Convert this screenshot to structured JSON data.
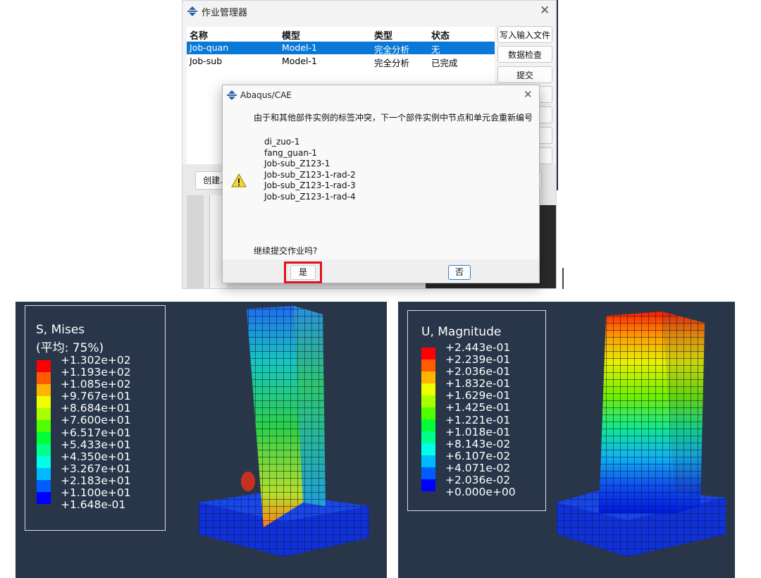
{
  "job_manager": {
    "title": "作业管理器",
    "columns": [
      "名称",
      "模型",
      "类型",
      "状态"
    ],
    "rows": [
      {
        "name": "Job-quan",
        "model": "Model-1",
        "type": "完全分析",
        "status": "无",
        "selected": true
      },
      {
        "name": "Job-sub",
        "model": "Model-1",
        "type": "完全分析",
        "status": "已完成",
        "selected": false
      }
    ],
    "buttons": {
      "write_input": "写入输入文件",
      "data_check": "数据检查",
      "submit": "提交",
      "create": "创建."
    }
  },
  "dialog": {
    "title": "Abaqus/CAE",
    "message": "由于和其他部件实例的标签冲突，下一个部件实例中节点和单元会重新编号",
    "instances": [
      "di_zuo-1",
      "fang_guan-1",
      "Job-sub_Z123-1",
      "Job-sub_Z123-1-rad-2",
      "Job-sub_Z123-1-rad-3",
      "Job-sub_Z123-1-rad-4"
    ],
    "question": "继续提交作业吗?",
    "yes_label": "是",
    "no_label": "否",
    "warning_icon": "warning-triangle-icon"
  },
  "stress_plot": {
    "title": "S, Mises",
    "subtitle": "(平均: 75%)",
    "values": [
      "+1.302e+02",
      "+1.193e+02",
      "+1.085e+02",
      "+9.767e+01",
      "+8.684e+01",
      "+7.600e+01",
      "+6.517e+01",
      "+5.433e+01",
      "+4.350e+01",
      "+3.267e+01",
      "+2.183e+01",
      "+1.100e+01",
      "+1.648e-01"
    ]
  },
  "displacement_plot": {
    "title": "U, Magnitude",
    "values": [
      "+2.443e-01",
      "+2.239e-01",
      "+2.036e-01",
      "+1.832e-01",
      "+1.629e-01",
      "+1.425e-01",
      "+1.221e-01",
      "+1.018e-01",
      "+8.143e-02",
      "+6.107e-02",
      "+4.071e-02",
      "+2.036e-02",
      "+0.000e+00"
    ]
  },
  "legend_colors": [
    "#ff0000",
    "#ff5a00",
    "#ffb400",
    "#f0ff00",
    "#a8ff00",
    "#4eff00",
    "#00ff34",
    "#00ff8c",
    "#00ffe6",
    "#00baff",
    "#005cff",
    "#0000ff"
  ],
  "colors": {
    "selection": "#0a78d7",
    "highlight_border": "#e4101b",
    "plot_background": "#293649"
  }
}
